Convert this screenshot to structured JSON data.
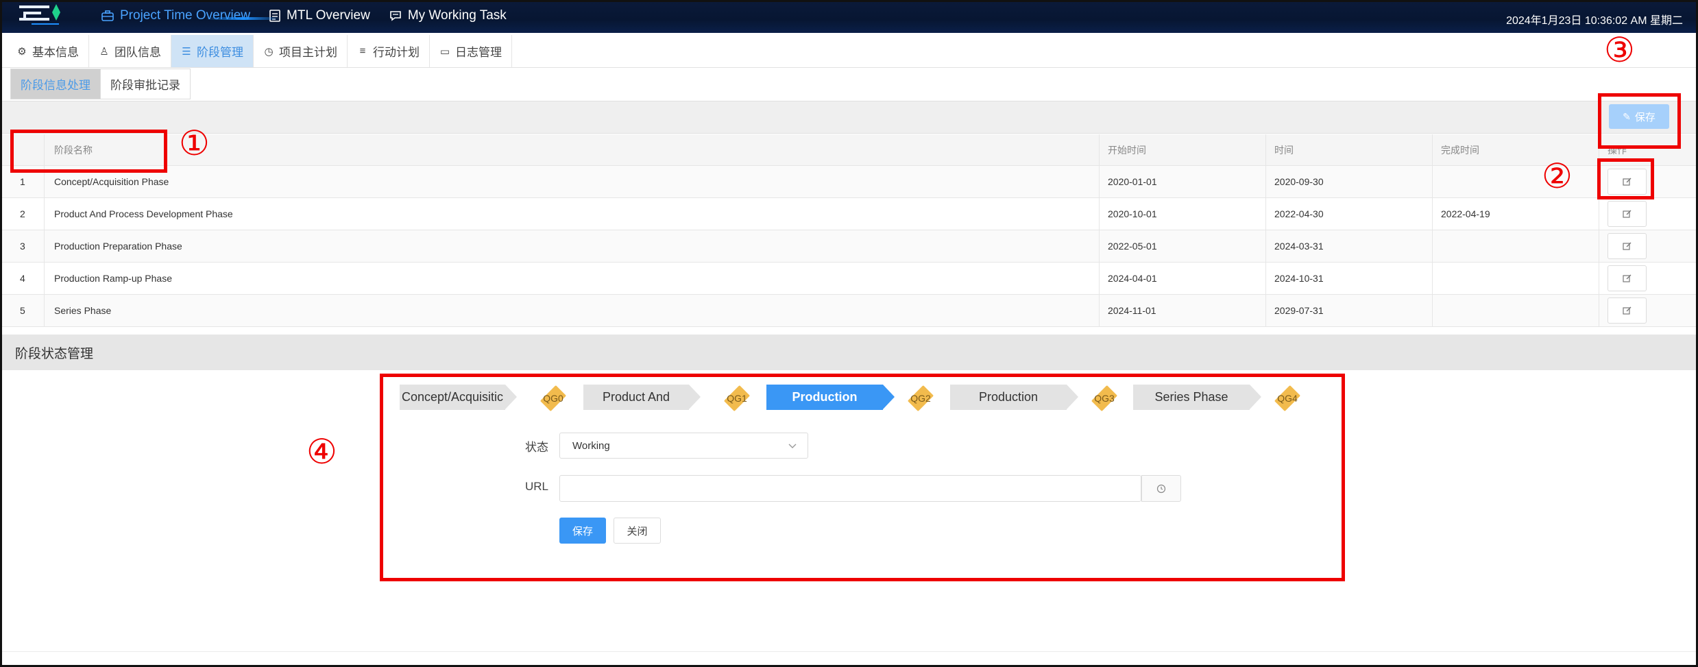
{
  "topbar": {
    "nav": [
      {
        "label": "Project Time Overview",
        "icon": "briefcase-icon",
        "active": true
      },
      {
        "label": "MTL Overview",
        "icon": "document-icon",
        "active": false
      },
      {
        "label": "My Working Task",
        "icon": "chat-icon",
        "active": false
      }
    ],
    "datetime": "2024年1月23日  10:36:02 AM  星期二"
  },
  "tabs_primary": [
    {
      "label": "基本信息",
      "icon": "gear-icon",
      "active": false
    },
    {
      "label": "团队信息",
      "icon": "user-icon",
      "active": false
    },
    {
      "label": "阶段管理",
      "icon": "list-icon",
      "active": true
    },
    {
      "label": "项目主计划",
      "icon": "clock-icon",
      "active": false
    },
    {
      "label": "行动计划",
      "icon": "menu-icon",
      "active": false
    },
    {
      "label": "日志管理",
      "icon": "card-icon",
      "active": false
    }
  ],
  "tabs_secondary": [
    {
      "label": "阶段信息处理",
      "active": true
    },
    {
      "label": "阶段审批记录",
      "active": false
    }
  ],
  "toolbar": {
    "save_label": "保存"
  },
  "table": {
    "headers": {
      "num": "",
      "name": "阶段名称",
      "start": "开始时间",
      "end": "时间",
      "done": "完成时间",
      "op": "操作"
    },
    "rows": [
      {
        "num": "1",
        "name": "Concept/Acquisition Phase",
        "start": "2020-01-01",
        "end": "2020-09-30",
        "done": ""
      },
      {
        "num": "2",
        "name": "Product And Process Development Phase",
        "start": "2020-10-01",
        "end": "2022-04-30",
        "done": "2022-04-19"
      },
      {
        "num": "3",
        "name": "Production Preparation Phase",
        "start": "2022-05-01",
        "end": "2024-03-31",
        "done": ""
      },
      {
        "num": "4",
        "name": "Production Ramp-up Phase",
        "start": "2024-04-01",
        "end": "2024-10-31",
        "done": ""
      },
      {
        "num": "5",
        "name": "Series Phase",
        "start": "2024-11-01",
        "end": "2029-07-31",
        "done": ""
      }
    ]
  },
  "section2": {
    "title": "阶段状态管理"
  },
  "steps": [
    {
      "label": "Concept/Acquisitic",
      "gate": "QG0",
      "active": false
    },
    {
      "label": "Product And",
      "gate": "QG1",
      "active": false
    },
    {
      "label": "Production",
      "gate": "QG2",
      "active": true
    },
    {
      "label": "Production",
      "gate": "QG3",
      "active": false
    },
    {
      "label": "Series Phase",
      "gate": "QG4",
      "active": false
    }
  ],
  "form": {
    "status_label": "状态",
    "status_value": "Working",
    "url_label": "URL",
    "url_value": "",
    "save_label": "保存",
    "close_label": "关闭"
  },
  "annotations": [
    "①",
    "②",
    "③",
    "④"
  ],
  "colors": {
    "accent": "#3a97f5",
    "highlight": "#ee0000",
    "gate": "#f2bb4d",
    "topbar": "#071632"
  }
}
